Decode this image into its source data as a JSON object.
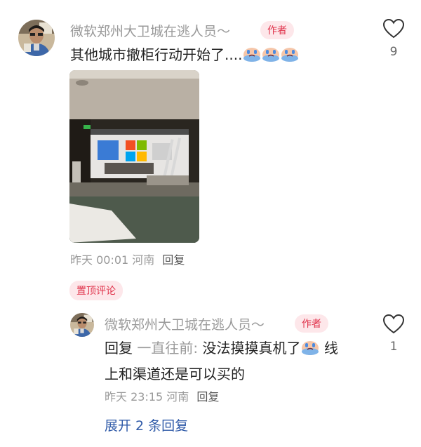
{
  "comment": {
    "username": "微软郑州大卫城在逃人员～",
    "author_badge": "作者",
    "text": "其他城市撤柜行动开始了....",
    "emoji": "crying-face-emoji",
    "likes": "9",
    "time": "昨天 00:01",
    "location": "河南",
    "reply_label": "回复"
  },
  "pinned_label": "置顶评论",
  "reply": {
    "username": "微软郑州大卫城在逃人员～",
    "author_badge": "作者",
    "prefix": "回复",
    "quoted_user": "一直往前:",
    "text_before": "没法摸摸真机了",
    "text_after": " 线",
    "text_line2": "上和渠道还是可以买的",
    "likes": "1",
    "time": "昨天 23:15",
    "location": "河南",
    "reply_label": "回复"
  },
  "expand_label": "展开 2 条回复",
  "colors": {
    "accent": "#e0334b",
    "badge_bg": "#fde7ea",
    "link": "#2f5aa8"
  }
}
